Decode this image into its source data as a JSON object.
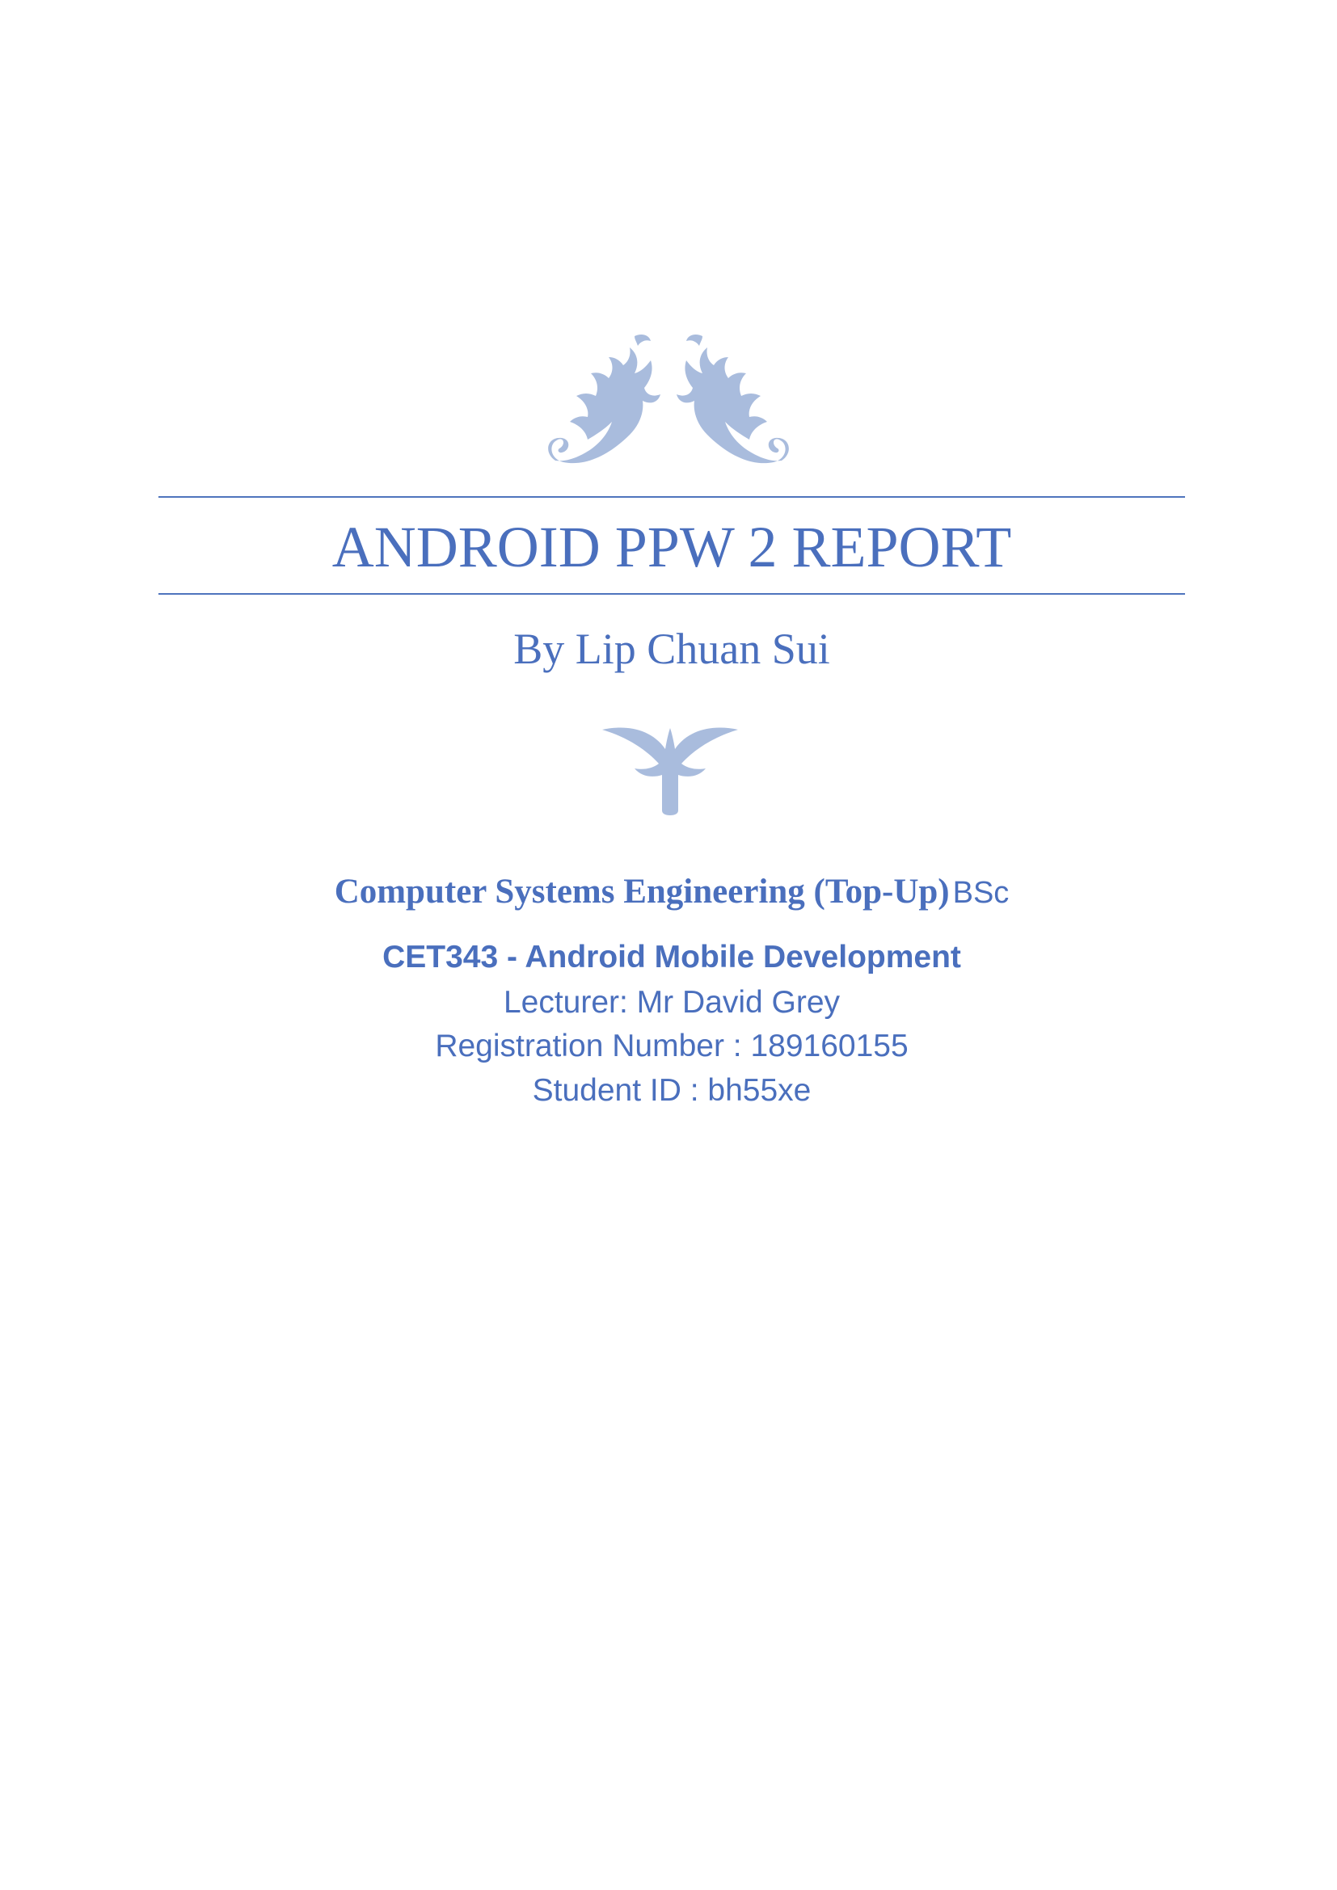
{
  "document": {
    "title": "ANDROID PPW 2 REPORT",
    "author_line": "By Lip Chuan Sui",
    "program_name": "Computer Systems Engineering (Top-Up)",
    "program_degree": "BSc",
    "module": "CET343 - Android Mobile Development",
    "lecturer": "Lecturer: Mr David Grey",
    "registration": "Registration Number : 189160155",
    "student_id": "Student ID : bh55xe"
  },
  "ornaments": {
    "top_icon": "floral-flourish-icon",
    "middle_icon": "leaf-flourish-icon"
  },
  "colors": {
    "text": "#4a6fbd",
    "ornament": "#a9bcdd",
    "rule": "#4f74bd"
  }
}
